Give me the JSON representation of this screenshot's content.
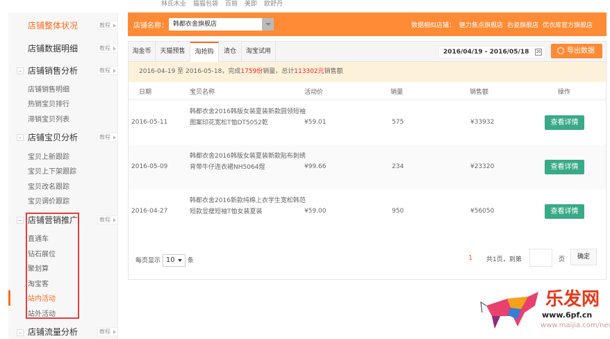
{
  "top_nav": [
    "林氏木业",
    "猫猫包袋",
    "百丽",
    "美即",
    "欧舒丹"
  ],
  "sidebar": {
    "tutorial_label": "教程",
    "sections": [
      {
        "label": "店铺整体状况",
        "active": true
      },
      {
        "label": "店铺数据明细"
      },
      {
        "label": "店铺销售分析",
        "items": [
          "店铺销售明细",
          "热销宝贝排行",
          "滞销宝贝列表"
        ]
      },
      {
        "label": "店铺宝贝分析",
        "items": [
          "宝贝上新跟踪",
          "宝贝上下架跟踪",
          "宝贝改名跟踪",
          "宝贝调价跟踪"
        ]
      },
      {
        "label": "店铺营销推广",
        "items": [
          "直通车",
          "钻石展位",
          "聚划算",
          "淘宝客",
          "站内活动",
          "站外活动"
        ],
        "active_item": "站内活动"
      },
      {
        "label": "店铺流量分析"
      }
    ]
  },
  "header": {
    "store_label": "店铺名称：",
    "store_value": "韩都衣舍旗舰店",
    "similar_label": "数据相似店铺：",
    "similar_stores": [
      "魅力焦点旗舰店",
      "右姿旗舰店",
      "优衣库官方旗舰店"
    ]
  },
  "tabs": [
    "淘金币",
    "天猫预售",
    "淘抢购",
    "清仓",
    "淘宝试用"
  ],
  "active_tab": "淘抢购",
  "date_range": "2016/04/19 - 2016/05/18",
  "calendar_day": "20",
  "export_label": "导出数据",
  "notice": {
    "prefix": "2016-04-19 至 2016-05-18，完成",
    "count": "1759份",
    "mid": "销量，总计",
    "amount": "113302元",
    "suffix": "销售额"
  },
  "table": {
    "headers": [
      "日期",
      "宝贝名称",
      "活动价",
      "销量",
      "销售额",
      "操作"
    ],
    "rows": [
      {
        "date": "2016-05-11",
        "name": "韩都衣舍2016韩版女装夏装新款圆领短袖图案印花宽松T恤DT5052乾",
        "price": "¥59.01",
        "qty": "575",
        "amount": "¥33932",
        "action": "查看详情"
      },
      {
        "date": "2016-05-09",
        "name": "韩都衣舍2016韩版女装夏装新款贴布刺绣背带牛仔连衣裙NH5064煜",
        "price": "¥99.66",
        "qty": "234",
        "amount": "¥23320",
        "action": "查看详情"
      },
      {
        "date": "2016-04-27",
        "name": "韩都衣舍2016新款纯棉上衣学生宽松韩范短款显瘦短袖T恤女装夏装",
        "price": "¥59.00",
        "qty": "950",
        "amount": "¥56050",
        "action": "查看详情"
      }
    ]
  },
  "pager": {
    "per_page_label": "每页显示",
    "per_page": "10",
    "per_page_unit": "条",
    "current": "1",
    "total_text": "共1页，到第",
    "page_unit": "页",
    "confirm": "确定"
  },
  "watermark": {
    "title": "乐发网",
    "url": "www.6pf.cn",
    "url2": "www.maijia.com/news"
  }
}
